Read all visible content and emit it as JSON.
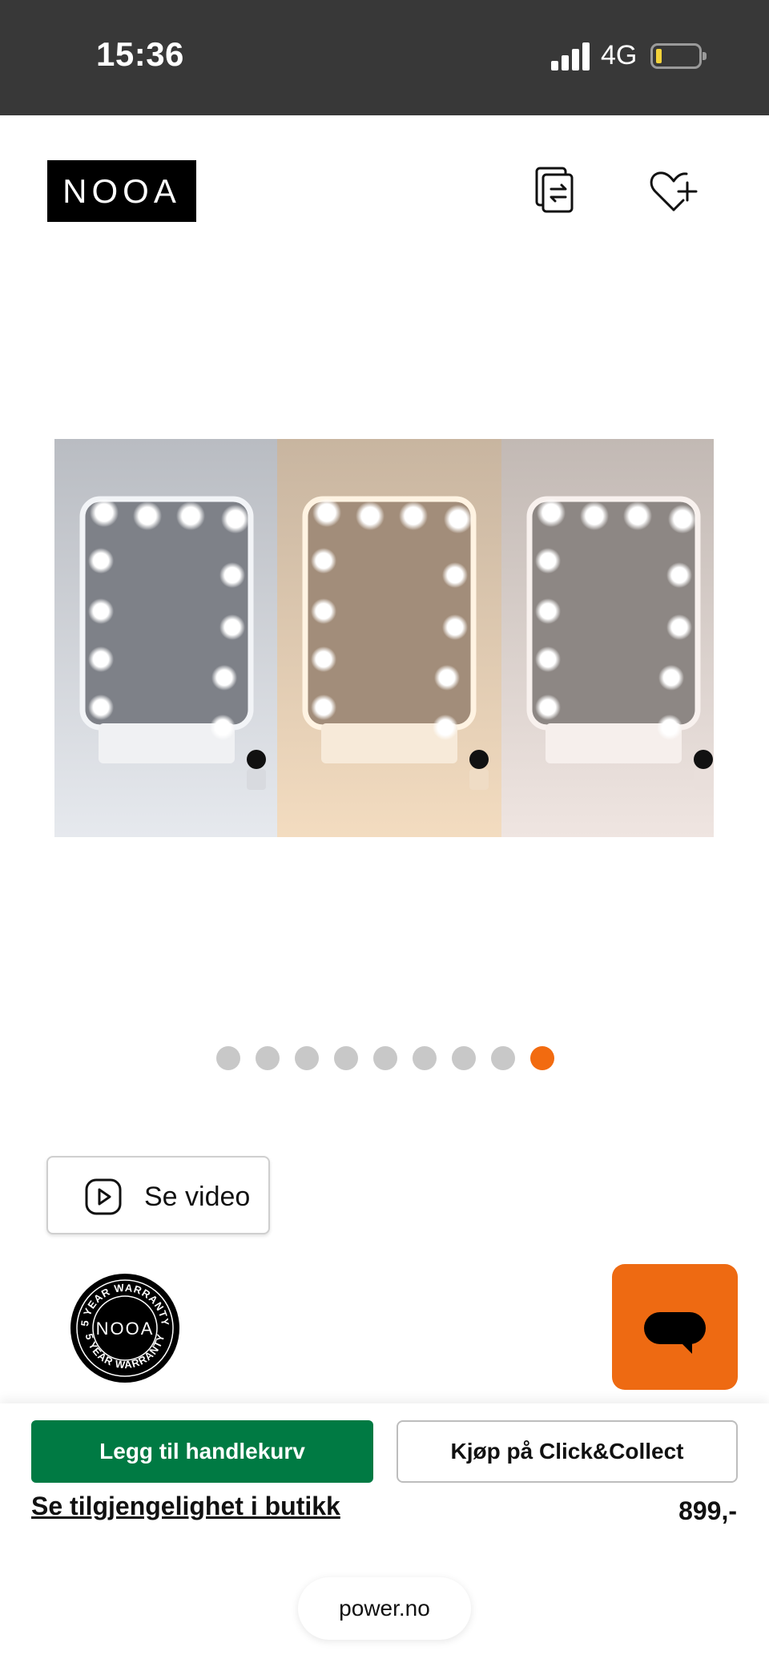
{
  "status_bar": {
    "time": "15:36",
    "network": "4G",
    "battery_level": 0.1,
    "battery_color": "#f4d33a"
  },
  "header": {
    "logo_text": "NOOA",
    "icons": [
      "compare-icon",
      "wishlist-add-icon"
    ]
  },
  "gallery": {
    "image_description_icon": "product-image",
    "dot_count": 9,
    "active_dot_index": 8,
    "active_color": "#f26b10"
  },
  "video": {
    "label": "Se video",
    "icon": "play-icon"
  },
  "warranty_badge": {
    "top_text": "5 YEAR WARRANTY",
    "brand": "NOOA",
    "bottom_text": "5 YEAR WARRANTY"
  },
  "chat": {
    "icon": "chat-icon",
    "color": "#ee6a12"
  },
  "purchase": {
    "add_to_cart_label": "Legg til handlekurv",
    "add_to_cart_color": "#007a43",
    "click_collect_label": "Kjøp på Click&Collect",
    "availability_link": "Se tilgjengelighet i butikk",
    "price": "899,-"
  },
  "browser": {
    "url": "power.no"
  }
}
